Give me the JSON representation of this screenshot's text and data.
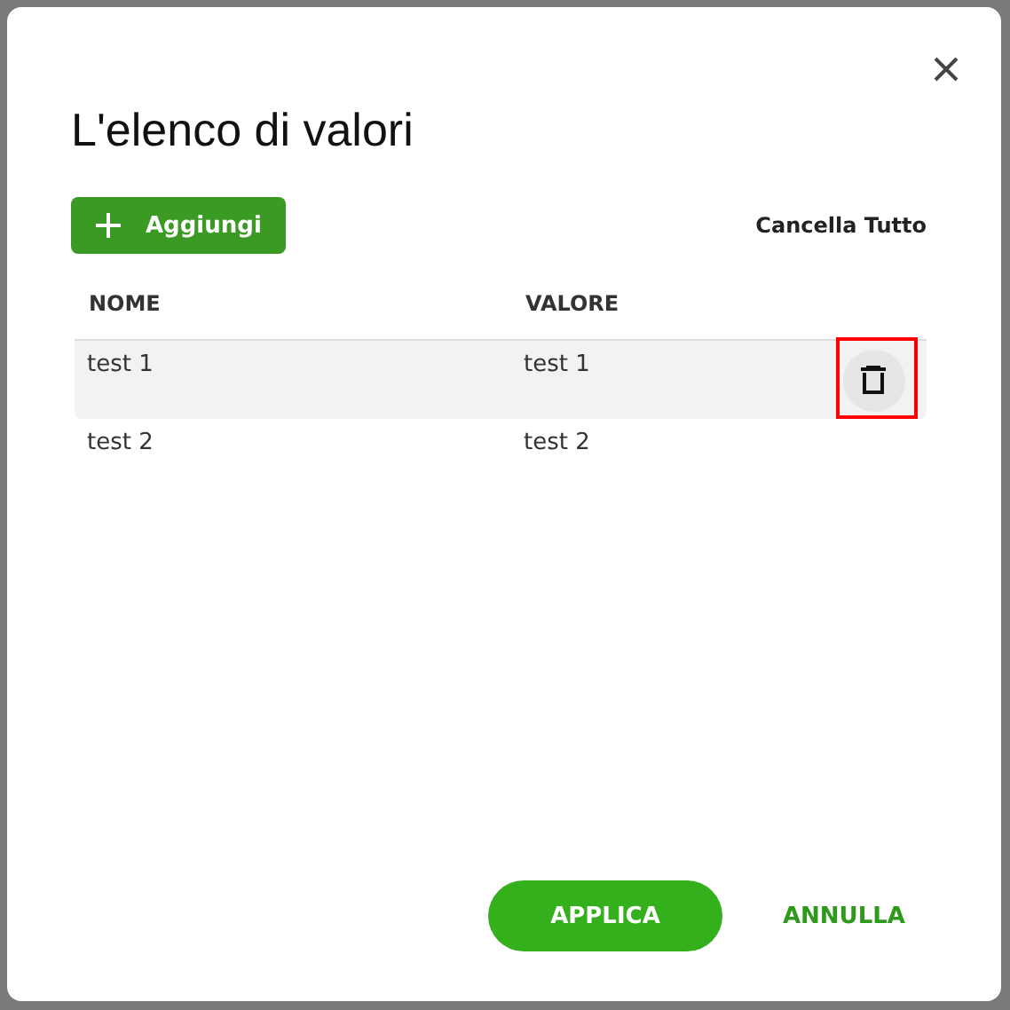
{
  "dialog": {
    "title": "L'elenco di valori",
    "add_button": "Aggiungi",
    "clear_all": "Cancella Tutto",
    "table": {
      "columns": [
        "NOME",
        "VALORE"
      ],
      "rows": [
        {
          "cells": [
            "test 1",
            "test 1"
          ],
          "hovered": true,
          "highlighted": true
        },
        {
          "cells": [
            "test 2",
            "test 2"
          ],
          "hovered": false,
          "highlighted": false
        }
      ]
    },
    "actions": [
      {
        "label": "APPLICA",
        "kind": "primary"
      },
      {
        "label": "ANNULLA",
        "kind": "text"
      }
    ]
  }
}
